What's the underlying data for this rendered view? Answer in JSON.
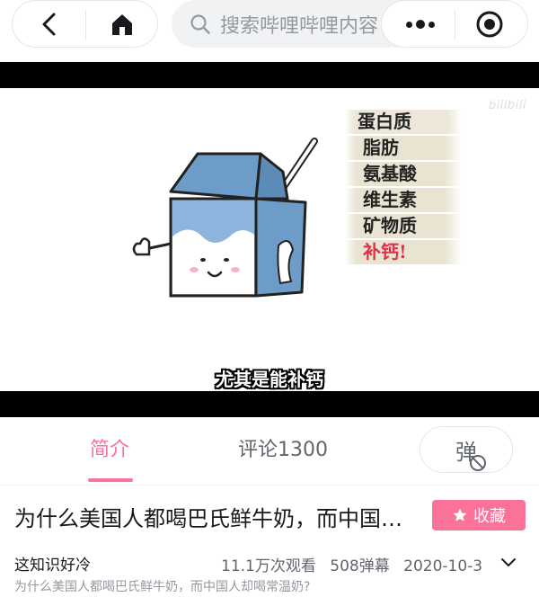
{
  "nav": {
    "back_icon": "chevron-left-icon",
    "home_icon": "home-icon",
    "more_icon": "more-dots-icon",
    "close_icon": "target-close-icon"
  },
  "search": {
    "placeholder": "搜索哔哩哔哩内容",
    "icon": "search-icon"
  },
  "video": {
    "watermark": "bilibili",
    "subtitle": "尤其是能补钙",
    "nutrients": [
      "蛋白质",
      "脂肪",
      "氨基酸",
      "维生素",
      "矿物质",
      "补钙!"
    ]
  },
  "tabs": {
    "intro": "简介",
    "comments": "评论1300",
    "danmaku_label": "弹"
  },
  "info": {
    "title": "为什么美国人都喝巴氏鲜牛奶，而中国人却喝常温奶？",
    "favorite_label": "收藏",
    "uploader": "这知识好冷",
    "views": "11.1万次观看",
    "danmaku_count": "508弹幕",
    "date": "2020-10-3",
    "description": "为什么美国人都喝巴氏鲜牛奶，而中国人却喝常温奶?"
  },
  "colors": {
    "accent": "#fb7299",
    "text": "#18191c",
    "muted": "#9499a0"
  }
}
